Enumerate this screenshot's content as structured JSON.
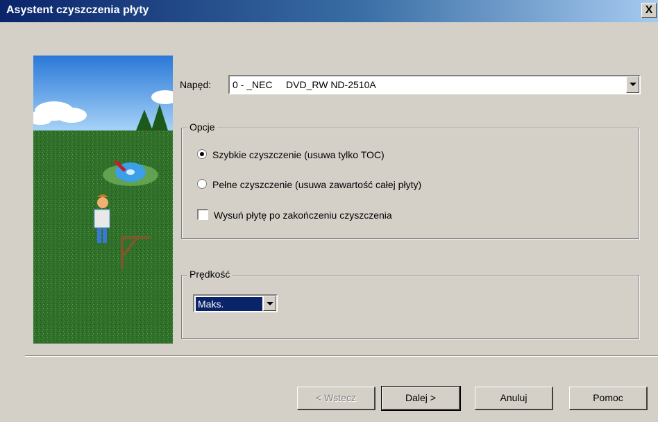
{
  "window": {
    "title": "Asystent czyszczenia płyty",
    "close_label": "X"
  },
  "drive": {
    "label": "Napęd:",
    "selected": "0 - _NEC     DVD_RW ND-2510A"
  },
  "options": {
    "legend": "Opcje",
    "items": [
      {
        "label": "Szybkie czyszczenie (usuwa tylko TOC)",
        "type": "radio",
        "checked": true
      },
      {
        "label": "Pełne czyszczenie (usuwa zawartość całej płyty)",
        "type": "radio",
        "checked": false
      },
      {
        "label": "Wysuń płytę po zakończeniu czyszczenia",
        "type": "checkbox",
        "checked": false
      }
    ]
  },
  "speed": {
    "legend": "Prędkość",
    "selected": "Maks."
  },
  "buttons": {
    "back": "< Wstecz",
    "next": "Dalej >",
    "cancel": "Anuluj",
    "help": "Pomoc"
  },
  "colors": {
    "title_start": "#0a246a",
    "title_end": "#a6caf0",
    "face": "#d4d0c8",
    "selection": "#0a246a"
  }
}
